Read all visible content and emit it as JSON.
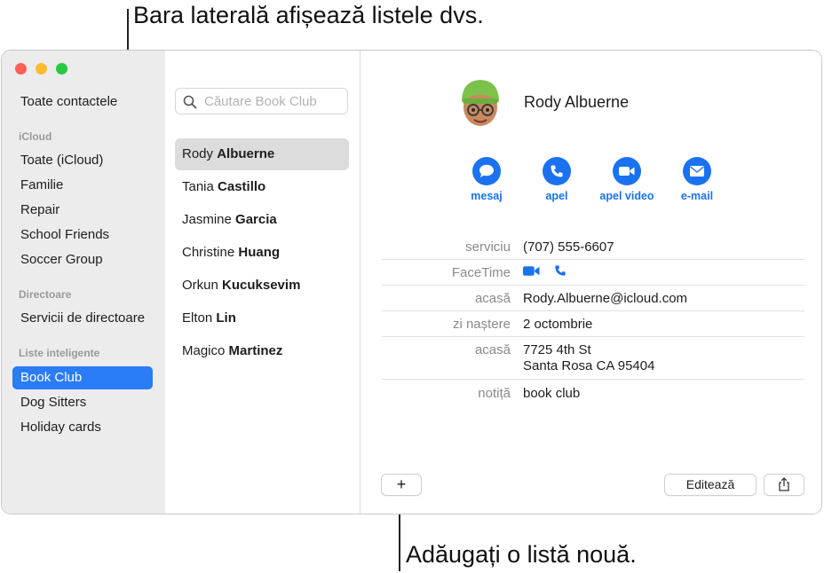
{
  "callouts": {
    "sidebar": "Bara laterală afișează listele dvs.",
    "add_list": "Adăugați o listă nouă."
  },
  "sidebar": {
    "all_contacts": "Toate contactele",
    "icloud_header": "iCloud",
    "icloud_items": [
      "Toate (iCloud)",
      "Familie",
      "Repair",
      "School Friends",
      "Soccer Group"
    ],
    "directories_header": "Directoare",
    "directory_services": "Servicii de directoare",
    "smart_header": "Liste inteligente",
    "smart_items": [
      "Book Club",
      "Dog Sitters",
      "Holiday cards"
    ],
    "selected": "Book Club"
  },
  "search": {
    "placeholder": "Căutare Book Club"
  },
  "contacts": [
    {
      "first": "Rody",
      "last": "Albuerne"
    },
    {
      "first": "Tania",
      "last": "Castillo"
    },
    {
      "first": "Jasmine",
      "last": "Garcia"
    },
    {
      "first": "Christine",
      "last": "Huang"
    },
    {
      "first": "Orkun",
      "last": "Kucuksevim"
    },
    {
      "first": "Elton",
      "last": "Lin"
    },
    {
      "first": "Magico",
      "last": "Martinez"
    }
  ],
  "detail": {
    "name": "Rody Albuerne",
    "actions": [
      "mesaj",
      "apel",
      "apel video",
      "e-mail"
    ],
    "fields": {
      "work_label": "serviciu",
      "work_value": "(707) 555-6607",
      "facetime_label": "FaceTime",
      "home_email_label": "acasă",
      "home_email_value": "Rody.Albuerne@icloud.com",
      "birthday_label": "zi naștere",
      "birthday_value": "2 octombrie",
      "home_address_label": "acasă",
      "address_line1": "7725 4th St",
      "address_line2": "Santa Rosa CA 95404",
      "note_label": "notiță",
      "note_value": "book club"
    },
    "buttons": {
      "add": "+",
      "edit": "Editează"
    }
  },
  "colors": {
    "accent": "#1a72f0",
    "selection": "#2a7cf7"
  }
}
